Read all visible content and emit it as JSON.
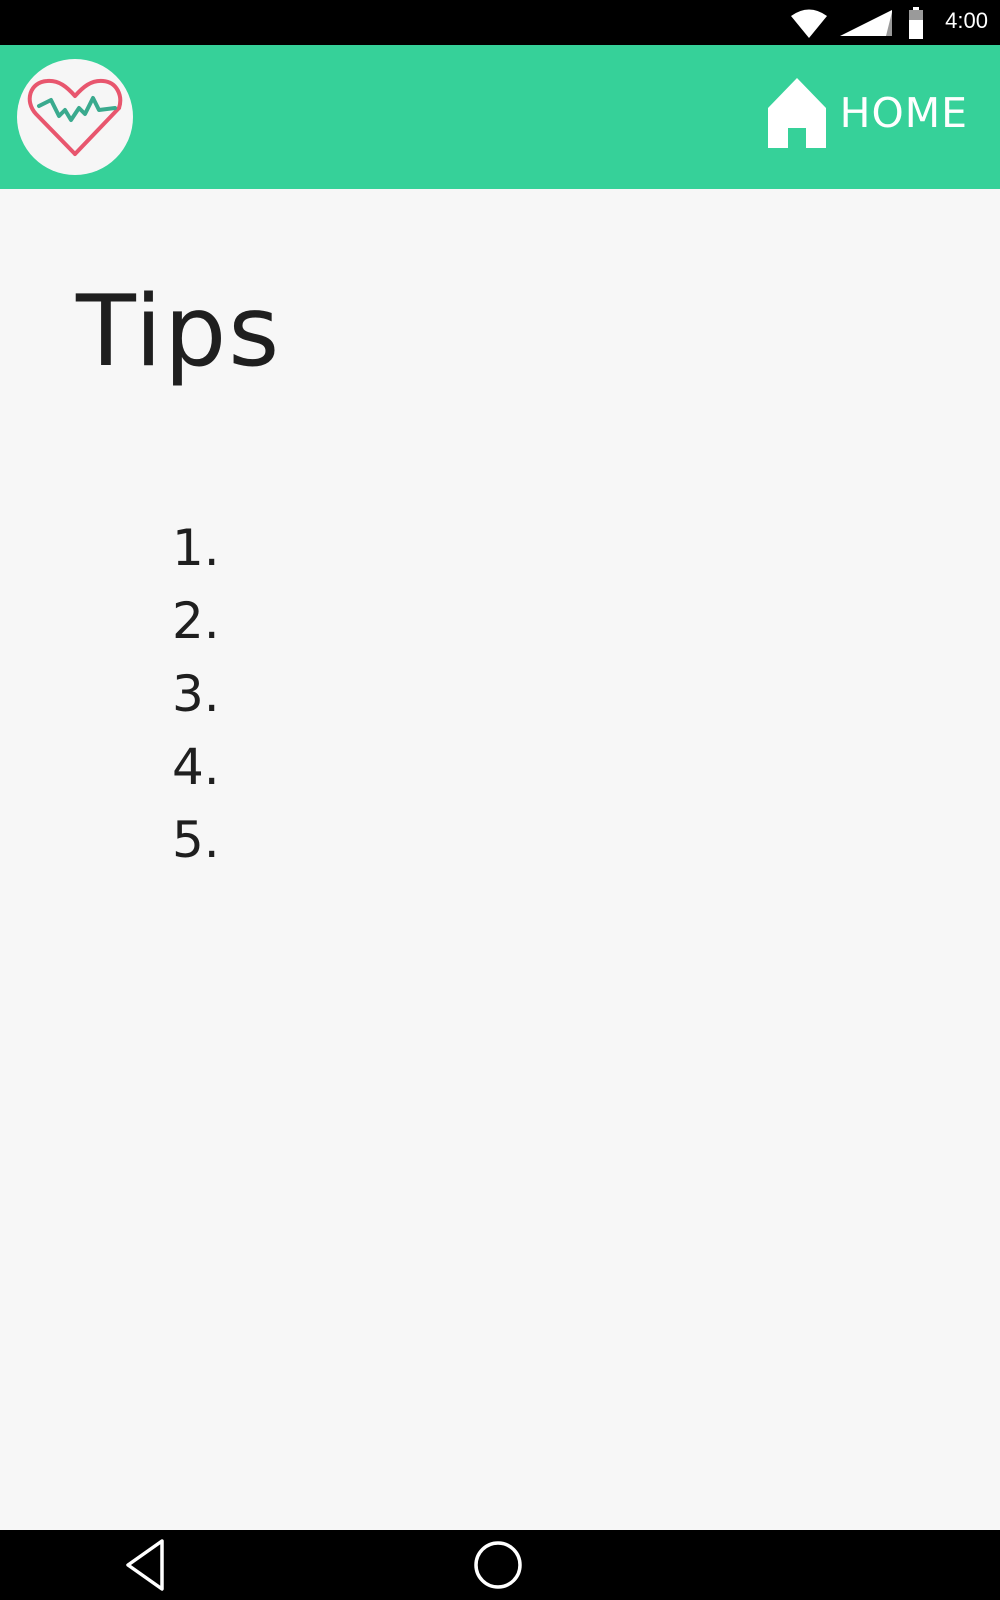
{
  "status_bar": {
    "time": "4:00",
    "icons": [
      "wifi-icon",
      "cell-signal-icon",
      "battery-icon"
    ]
  },
  "app_bar": {
    "background_color": "#36d199",
    "logo_icon": "heart-pulse-icon",
    "home_icon": "house-icon",
    "home_label": "HOME"
  },
  "page": {
    "title": "Tips",
    "tips": [
      {
        "number": "1."
      },
      {
        "number": "2."
      },
      {
        "number": "3."
      },
      {
        "number": "4."
      },
      {
        "number": "5."
      }
    ]
  },
  "nav_bar": {
    "icons": [
      "back-triangle-icon",
      "home-circle-icon"
    ]
  }
}
